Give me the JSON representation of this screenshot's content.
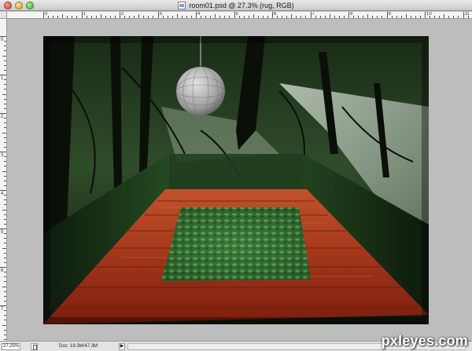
{
  "window": {
    "title": "room01.psd @ 27.3% (rug, RGB)",
    "buttons": [
      "close",
      "minimize",
      "zoom"
    ],
    "doc_icon": "psd-file-icon"
  },
  "rulers": {
    "horizontal_labels": [
      "0",
      "1",
      "2",
      "3",
      "4",
      "5",
      "6",
      "7",
      "8",
      "9",
      "10",
      "11"
    ],
    "vertical_labels": [
      "0",
      "1",
      "2",
      "3",
      "4",
      "5",
      "6",
      "7"
    ]
  },
  "status": {
    "zoom": "27.25%",
    "doc_info": "Doc: 19.3M/47.3M",
    "menu_arrow": "▶"
  },
  "canvas": {
    "scene": "forest room with wooden floor, leafy rug and paper lantern",
    "colors": {
      "forest_dark": "#0f1d0e",
      "forest_green": "#2f5a25",
      "floor_wood": "#a1361a",
      "rug_green": "#3f7a3a",
      "lantern": "#b7b7b7"
    }
  },
  "watermark": {
    "text": "pxleyes.com"
  }
}
